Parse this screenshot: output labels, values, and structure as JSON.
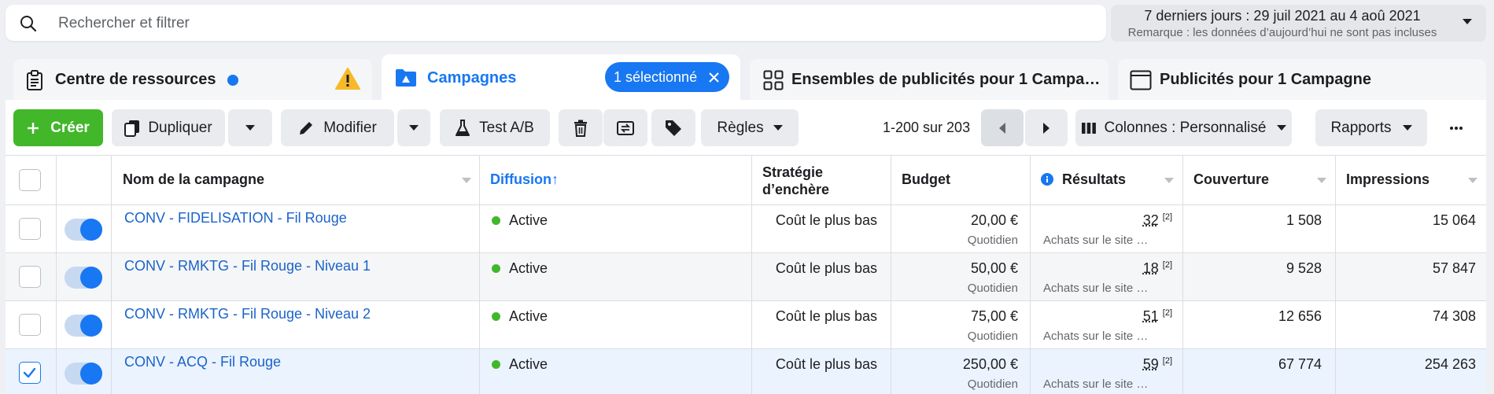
{
  "search": {
    "placeholder": "Rechercher et filtrer"
  },
  "date_range": {
    "label": "7 derniers jours : 29 juil 2021 au 4 aoû 2021",
    "note": "Remarque : les données d’aujourd’hui ne sont pas incluses"
  },
  "tabs": [
    {
      "label": "Centre de ressources"
    },
    {
      "label": "Campagnes",
      "badge": "1 sélectionné"
    },
    {
      "label": "Ensembles de publicités pour 1 Campa…"
    },
    {
      "label": "Publicités pour 1 Campagne"
    }
  ],
  "toolbar": {
    "create": "Créer",
    "duplicate": "Dupliquer",
    "edit": "Modifier",
    "ab_test": "Test A/B",
    "rules": "Règles",
    "pagination": "1-200 sur 203",
    "columns": "Colonnes : Personnalisé",
    "reports": "Rapports"
  },
  "table": {
    "headers": {
      "name": "Nom de la campagne",
      "delivery": "Diffusion",
      "delivery_sort": "↑",
      "bid_strategy_1": "Stratégie",
      "bid_strategy_2": "d’enchère",
      "budget": "Budget",
      "results": "Résultats",
      "reach": "Couverture",
      "impressions": "Impressions"
    },
    "rows": [
      {
        "checked": false,
        "name": "CONV - FIDELISATION - Fil Rouge",
        "delivery": "Active",
        "bid": "Coût le plus bas",
        "budget": "20,00 €",
        "budget_type": "Quotidien",
        "results": "32",
        "results_note": "[2]",
        "results_label": "Achats sur le site …",
        "reach": "1 508",
        "impressions": "15 064"
      },
      {
        "checked": false,
        "name": "CONV - RMKTG - Fil Rouge - Niveau 1",
        "delivery": "Active",
        "bid": "Coût le plus bas",
        "budget": "50,00 €",
        "budget_type": "Quotidien",
        "results": "18",
        "results_note": "[2]",
        "results_label": "Achats sur le site …",
        "reach": "9 528",
        "impressions": "57 847"
      },
      {
        "checked": false,
        "name": "CONV - RMKTG - Fil Rouge - Niveau 2",
        "delivery": "Active",
        "bid": "Coût le plus bas",
        "budget": "75,00 €",
        "budget_type": "Quotidien",
        "results": "51",
        "results_note": "[2]",
        "results_label": "Achats sur le site …",
        "reach": "12 656",
        "impressions": "74 308"
      },
      {
        "checked": true,
        "name": "CONV - ACQ - Fil Rouge",
        "delivery": "Active",
        "bid": "Coût le plus bas",
        "budget": "250,00 €",
        "budget_type": "Quotidien",
        "results": "59",
        "results_note": "[2]",
        "results_label": "Achats sur le site …",
        "reach": "67 774",
        "impressions": "254 263"
      }
    ]
  },
  "colors": {
    "accent": "#1877f2",
    "create_green": "#42b72a",
    "warning": "#f7b928"
  }
}
